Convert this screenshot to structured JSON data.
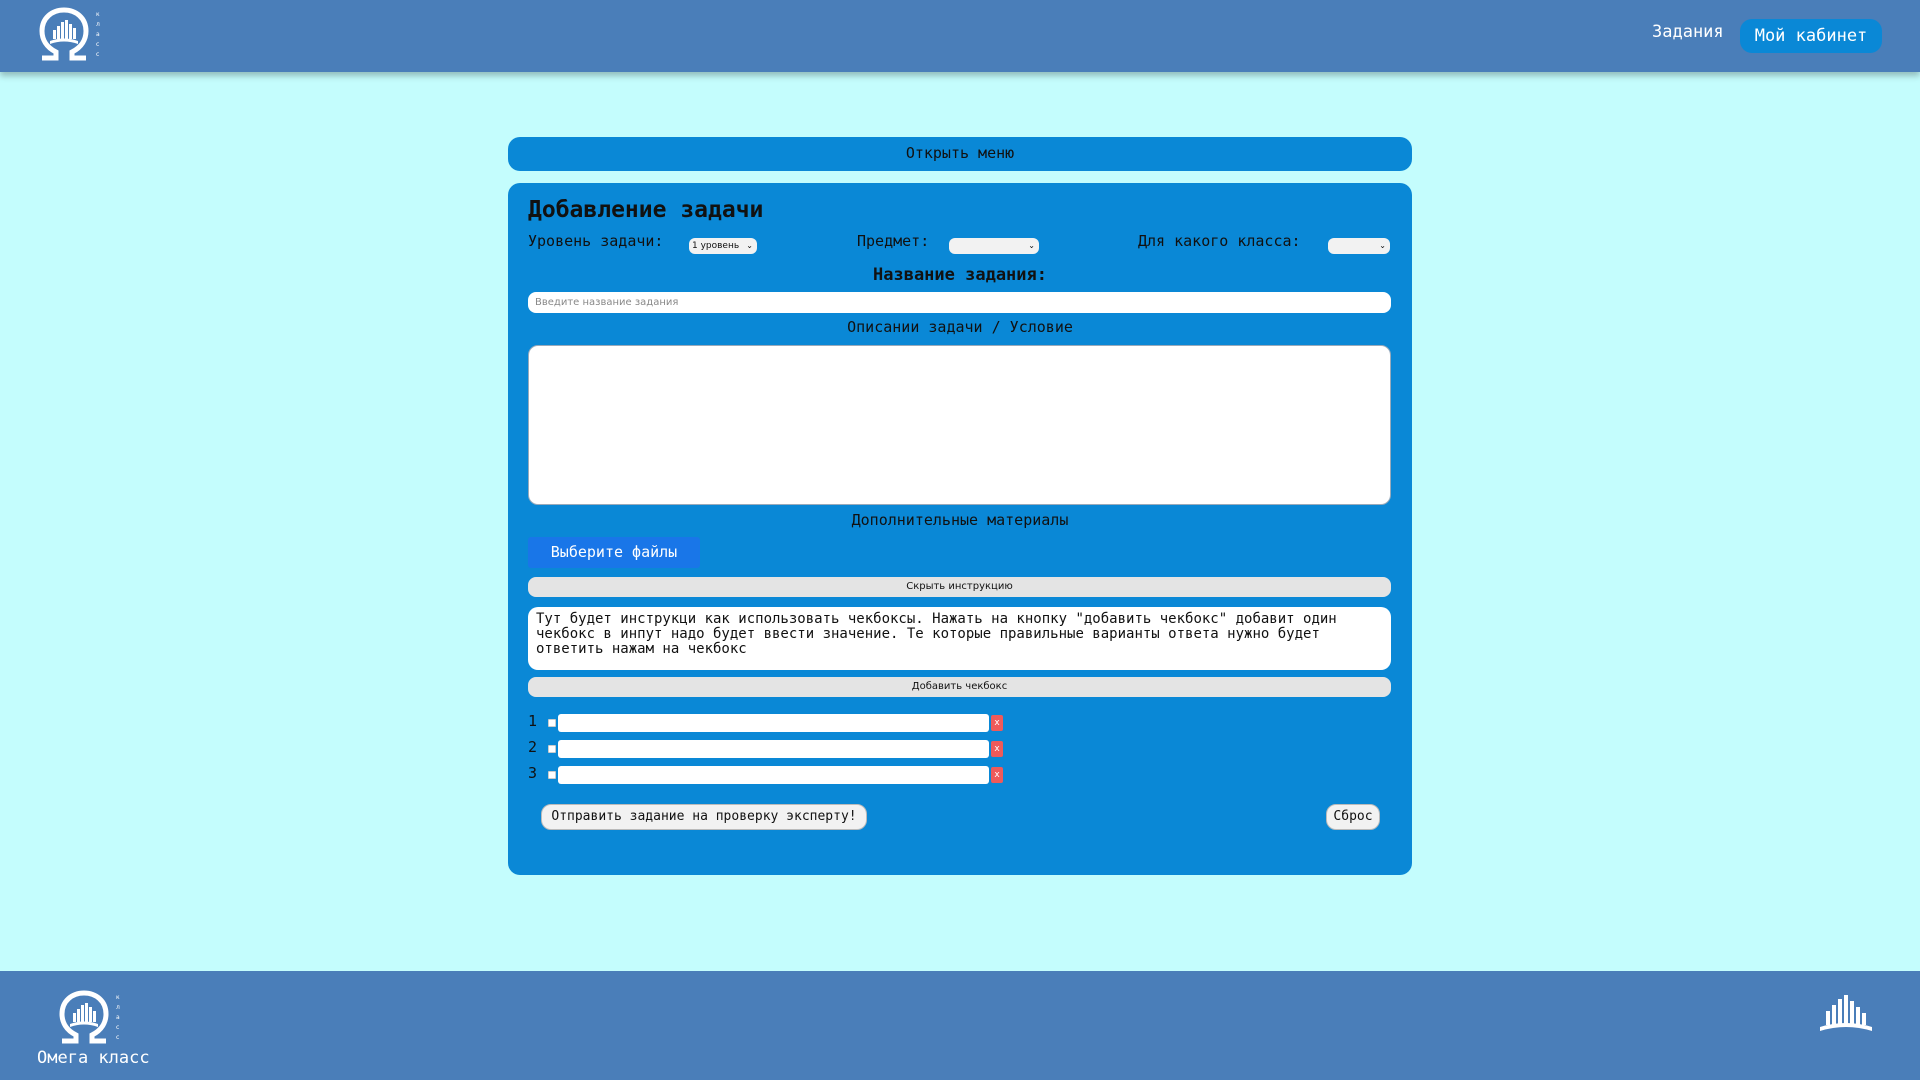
{
  "header": {
    "logo_icon": "omega-logo-icon",
    "nav_tasks": "Задания",
    "nav_cabinet": "Мой кабинет"
  },
  "menu": {
    "open_label": "Открыть меню"
  },
  "form": {
    "title": "Добавление задачи",
    "level_label": "Уровень задачи:",
    "level_value": "1 уровень",
    "subject_label": "Предмет:",
    "subject_value": "",
    "class_label": "Для какого класса:",
    "class_value": "",
    "name_label": "Название задания:",
    "name_placeholder": "Введите название задания",
    "desc_label": "Описании задачи / Условие",
    "materials_label": "Дополнительные материалы",
    "files_button": "Выберите файлы",
    "hide_instruction_button": "Скрыть инструкцию",
    "instruction_text": "Тут будет инструкци как использовать чекбоксы. Нажать на кнопку \"добавить чекбокс\" добавит один чекбокс в инпут надо будет ввести значение. Те которые правильные варианты ответа нужно будет ответить нажам на чекбокс",
    "add_checkbox_button": "Добавить чекбокс",
    "checkboxes": [
      {
        "num": "1",
        "value": "",
        "delete": "x"
      },
      {
        "num": "2",
        "value": "",
        "delete": "x"
      },
      {
        "num": "3",
        "value": "",
        "delete": "x"
      }
    ],
    "submit_button": "Отправить задание на проверку эксперту!",
    "reset_button": "Сброс"
  },
  "footer": {
    "logo_icon": "omega-logo-icon",
    "name": "Омега класс",
    "right_icon": "book-columns-icon"
  },
  "colors": {
    "background": "#c4fdfd",
    "bar": "#4a7eb9",
    "accent": "#0a88d6",
    "file_button": "#1976e8",
    "delete": "#ef5a5a"
  }
}
